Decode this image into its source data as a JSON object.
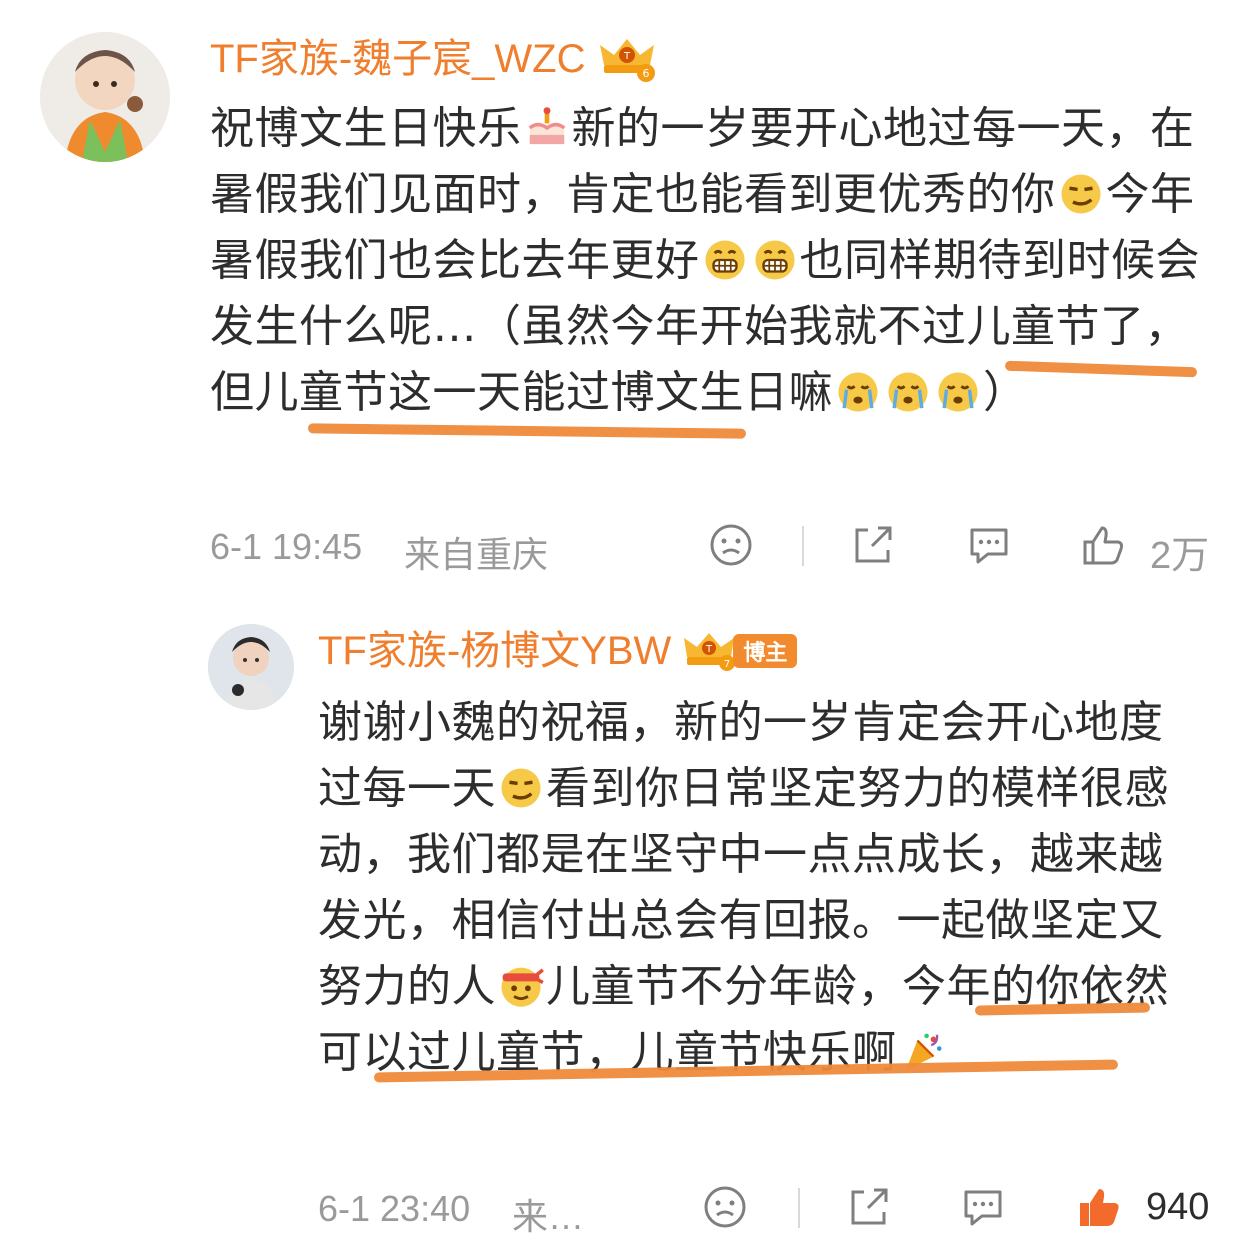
{
  "comments": [
    {
      "username": "TF家族-魏子宸_WZC",
      "content_parts": [
        "祝博文生日快乐",
        "新的一岁要开心地过每一天，在暑假我们见面时，肯定也能看到更优秀的你",
        "今年暑假我们也会比去年更好",
        "也同样期待到时候会发生什么呢…（虽然今年开始我就不过儿童节了，但儿童节这一天能过博文生日嘛",
        "）"
      ],
      "time": "6-1 19:45",
      "location": "来自重庆",
      "likes": "2万",
      "icons": [
        "cake-emoji",
        "smirk-emoji",
        "grin-emoji",
        "grin-emoji",
        "cry-emoji",
        "cry-emoji",
        "cry-emoji"
      ]
    },
    {
      "username": "TF家族-杨博文YBW",
      "badge": "博主",
      "content_parts": [
        "谢谢小魏的祝福，新的一岁肯定会开心地度过每一天",
        "看到你日常坚定努力的模样很感动，我们都是在坚守中一点点成长，越来越发光，相信付出总会有回报。一起做坚定又努力的人",
        "儿童节不分年龄，今年的你依然可以过儿童节，儿童节快乐啊",
        ""
      ],
      "time": "6-1 23:40",
      "location": "来…",
      "likes": "940",
      "icons": [
        "smirk-emoji",
        "headband-emoji",
        "party-popper-emoji"
      ]
    }
  ],
  "colors": {
    "username": "#ef7f2e",
    "meta": "#9a9a9a",
    "underline": "#ee8a3b"
  }
}
